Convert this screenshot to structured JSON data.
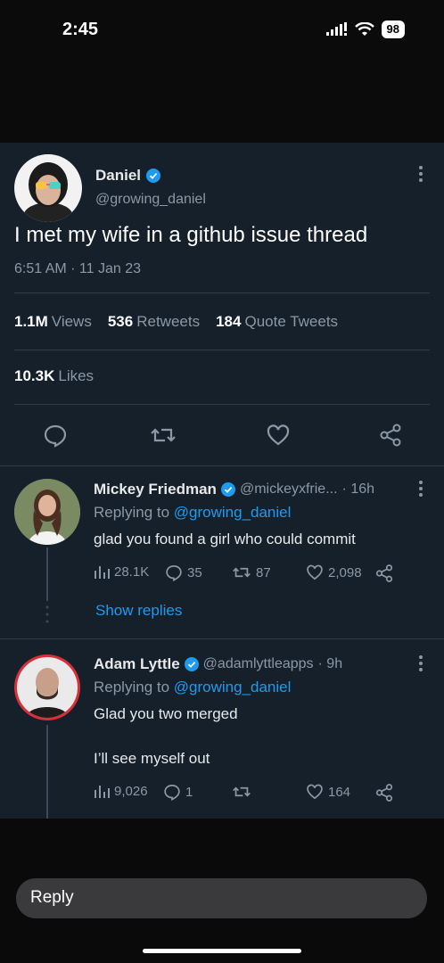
{
  "status_bar": {
    "time": "2:45",
    "battery": "98"
  },
  "tweet": {
    "author_name": "Daniel",
    "author_handle": "@growing_daniel",
    "text": "I met my wife in a github issue thread",
    "timestamp": "6:51 AM · 11 Jan 23",
    "stats": {
      "views_value": "1.1M",
      "views_label": "Views",
      "retweets_value": "536",
      "retweets_label": "Retweets",
      "quotes_value": "184",
      "quotes_label": "Quote Tweets",
      "likes_value": "10.3K",
      "likes_label": "Likes"
    }
  },
  "replies": [
    {
      "name": "Mickey Friedman",
      "handle": "@mickeyxfrie...",
      "age": "· 16h",
      "replying_prefix": "Replying to ",
      "replying_to": "@growing_daniel",
      "text": "glad you found a girl who could commit",
      "views": "28.1K",
      "comments": "35",
      "retweets": "87",
      "likes": "2,098",
      "show_replies": "Show replies"
    },
    {
      "name": "Adam Lyttle",
      "handle": "@adamlyttleapps",
      "age": "· 9h",
      "replying_prefix": "Replying to ",
      "replying_to": "@growing_daniel",
      "text_line1": "Glad you two merged",
      "text_line2": "I’ll see myself out",
      "views": "9,026",
      "comments": "1",
      "retweets": "",
      "likes": "164"
    }
  ],
  "composer": {
    "placeholder": "Reply"
  },
  "colors": {
    "accent": "#1d9bf0",
    "background": "#15202b",
    "muted": "#8b98a5"
  }
}
